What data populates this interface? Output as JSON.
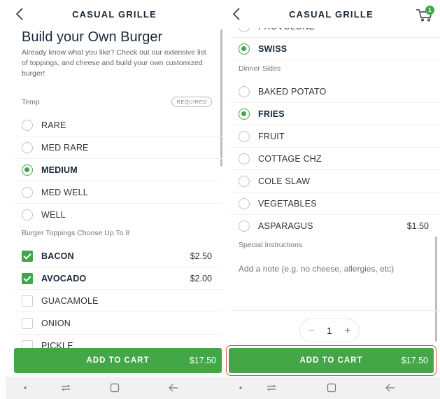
{
  "left_screen": {
    "header": {
      "title": "CASUAL GRILLE"
    },
    "page_title": "Build your Own Burger",
    "description": "Already know what you like? Check out our extensive list of toppings, and cheese and build your own customized burger!",
    "temp": {
      "label": "Temp",
      "required_badge": "REQUIRED",
      "options": [
        {
          "label": "RARE",
          "selected": false
        },
        {
          "label": "MED RARE",
          "selected": false
        },
        {
          "label": "MEDIUM",
          "selected": true
        },
        {
          "label": "MED WELL",
          "selected": false
        },
        {
          "label": "WELL",
          "selected": false
        }
      ]
    },
    "toppings": {
      "label": "Burger Toppings  Choose Up To 8",
      "options": [
        {
          "label": "BACON",
          "checked": true,
          "price": "$2.50"
        },
        {
          "label": "AVOCADO",
          "checked": true,
          "price": "$2.00"
        },
        {
          "label": "GUACAMOLE",
          "checked": false,
          "price": ""
        },
        {
          "label": "ONION",
          "checked": false,
          "price": ""
        },
        {
          "label": "PICKLE",
          "checked": false,
          "price": ""
        }
      ]
    },
    "add_to_cart": {
      "label": "ADD TO CART",
      "amount": "$17.50"
    }
  },
  "right_screen": {
    "header": {
      "title": "CASUAL GRILLE",
      "cart_count": "1"
    },
    "cheese_options": [
      {
        "label": "PROVOLONE",
        "selected": false
      },
      {
        "label": "SWISS",
        "selected": true
      }
    ],
    "dinner_sides": {
      "label": "Dinner Sides",
      "options": [
        {
          "label": "BAKED POTATO",
          "selected": false,
          "price": ""
        },
        {
          "label": "FRIES",
          "selected": true,
          "price": ""
        },
        {
          "label": "FRUIT",
          "selected": false,
          "price": ""
        },
        {
          "label": "COTTAGE CHZ",
          "selected": false,
          "price": ""
        },
        {
          "label": "COLE SLAW",
          "selected": false,
          "price": ""
        },
        {
          "label": "VEGETABLES",
          "selected": false,
          "price": ""
        },
        {
          "label": "ASPARAGUS",
          "selected": false,
          "price": "$1.50"
        }
      ]
    },
    "special_instructions": {
      "label": "Special Instructions",
      "placeholder": "Add a note (e.g. no cheese, allergies, etc)"
    },
    "quantity": {
      "minus": "−",
      "value": "1",
      "plus": "+"
    },
    "add_to_cart": {
      "label": "ADD TO CART",
      "amount": "$17.50"
    }
  },
  "colors": {
    "accent": "#43a748",
    "title": "#1b2838",
    "highlight": "#e24b4b"
  },
  "icons": [
    "back-arrow-icon",
    "cart-icon",
    "nav-dot-icon",
    "nav-recent-icon",
    "nav-home-icon",
    "nav-back-icon"
  ]
}
